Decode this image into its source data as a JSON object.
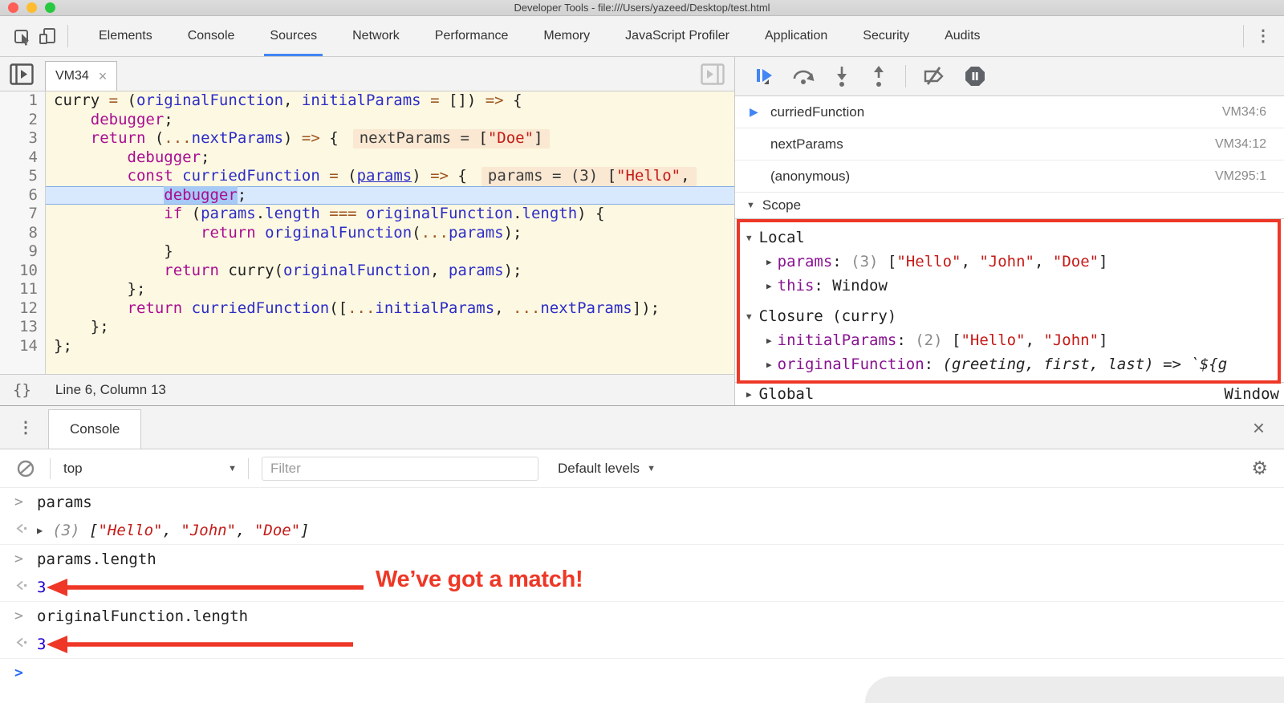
{
  "titlebar": {
    "title": "Developer Tools - file:///Users/yazeed/Desktop/test.html",
    "window_controls": [
      "close",
      "minimize",
      "zoom"
    ]
  },
  "main_toolbar": {
    "icons": [
      "inspect-icon",
      "device-toolbar-icon",
      "more-menu-icon"
    ],
    "tabs": [
      {
        "label": "Elements",
        "active": false
      },
      {
        "label": "Console",
        "active": false
      },
      {
        "label": "Sources",
        "active": true
      },
      {
        "label": "Network",
        "active": false
      },
      {
        "label": "Performance",
        "active": false
      },
      {
        "label": "Memory",
        "active": false
      },
      {
        "label": "JavaScript Profiler",
        "active": false
      },
      {
        "label": "Application",
        "active": false
      },
      {
        "label": "Security",
        "active": false
      },
      {
        "label": "Audits",
        "active": false
      }
    ]
  },
  "sources_panel": {
    "file_tab": {
      "label": "VM34",
      "close": "×"
    },
    "tabstrip_icons": [
      "navigator-toggle-icon",
      "debugger-pane-toggle-icon"
    ],
    "status_bar": {
      "pretty_print": "{}",
      "position": "Line 6, Column 13"
    },
    "code_lines": [
      {
        "num": 1,
        "tokens": [
          [
            "p",
            "curry "
          ],
          [
            "o",
            "="
          ],
          [
            "p",
            " ("
          ],
          [
            "v",
            "originalFunction"
          ],
          [
            "p",
            ", "
          ],
          [
            "v",
            "initialParams"
          ],
          [
            "p",
            " "
          ],
          [
            "o",
            "="
          ],
          [
            "p",
            " []) "
          ],
          [
            "o",
            "=>"
          ],
          [
            "p",
            " {"
          ]
        ]
      },
      {
        "num": 2,
        "tokens": [
          [
            "p",
            "    "
          ],
          [
            "k",
            "debugger"
          ],
          [
            "p",
            ";"
          ]
        ]
      },
      {
        "num": 3,
        "tokens": [
          [
            "p",
            "    "
          ],
          [
            "k",
            "return"
          ],
          [
            "p",
            " ("
          ],
          [
            "o",
            "..."
          ],
          [
            "v",
            "nextParams"
          ],
          [
            "p",
            ") "
          ],
          [
            "o",
            "=>"
          ],
          [
            "p",
            " {"
          ]
        ],
        "widget": [
          [
            "wp",
            "nextParams = "
          ],
          [
            "p",
            "["
          ],
          [
            "s",
            "\"Doe\""
          ],
          [
            "p",
            "]"
          ]
        ]
      },
      {
        "num": 4,
        "tokens": [
          [
            "p",
            "        "
          ],
          [
            "k",
            "debugger"
          ],
          [
            "p",
            ";"
          ]
        ]
      },
      {
        "num": 5,
        "tokens": [
          [
            "p",
            "        "
          ],
          [
            "k",
            "const"
          ],
          [
            "p",
            " "
          ],
          [
            "v",
            "curriedFunction"
          ],
          [
            "p",
            " "
          ],
          [
            "o",
            "="
          ],
          [
            "p",
            " ("
          ],
          [
            "vu",
            "params"
          ],
          [
            "p",
            ") "
          ],
          [
            "o",
            "=>"
          ],
          [
            "p",
            " {"
          ]
        ],
        "widget": [
          [
            "wp",
            "params = (3) "
          ],
          [
            "p",
            "["
          ],
          [
            "s",
            "\"Hello\""
          ],
          [
            "p",
            ","
          ]
        ]
      },
      {
        "num": 6,
        "highlight": true,
        "tokens": [
          [
            "p",
            "            "
          ],
          [
            "ksel",
            "debugger"
          ],
          [
            "p",
            ";"
          ]
        ]
      },
      {
        "num": 7,
        "tokens": [
          [
            "p",
            "            "
          ],
          [
            "k",
            "if"
          ],
          [
            "p",
            " ("
          ],
          [
            "v",
            "params"
          ],
          [
            "p",
            "."
          ],
          [
            "v",
            "length"
          ],
          [
            "p",
            " "
          ],
          [
            "o",
            "==="
          ],
          [
            "p",
            " "
          ],
          [
            "v",
            "originalFunction"
          ],
          [
            "p",
            "."
          ],
          [
            "v",
            "length"
          ],
          [
            "p",
            ") {"
          ]
        ]
      },
      {
        "num": 8,
        "tokens": [
          [
            "p",
            "                "
          ],
          [
            "k",
            "return"
          ],
          [
            "p",
            " "
          ],
          [
            "v",
            "originalFunction"
          ],
          [
            "p",
            "("
          ],
          [
            "o",
            "..."
          ],
          [
            "v",
            "params"
          ],
          [
            "p",
            ");"
          ]
        ]
      },
      {
        "num": 9,
        "tokens": [
          [
            "p",
            "            }"
          ]
        ]
      },
      {
        "num": 10,
        "tokens": [
          [
            "p",
            "            "
          ],
          [
            "k",
            "return"
          ],
          [
            "p",
            " curry("
          ],
          [
            "v",
            "originalFunction"
          ],
          [
            "p",
            ", "
          ],
          [
            "v",
            "params"
          ],
          [
            "p",
            ");"
          ]
        ]
      },
      {
        "num": 11,
        "tokens": [
          [
            "p",
            "        };"
          ]
        ]
      },
      {
        "num": 12,
        "tokens": [
          [
            "p",
            "        "
          ],
          [
            "k",
            "return"
          ],
          [
            "p",
            " "
          ],
          [
            "v",
            "curriedFunction"
          ],
          [
            "p",
            "(["
          ],
          [
            "o",
            "..."
          ],
          [
            "v",
            "initialParams"
          ],
          [
            "p",
            ", "
          ],
          [
            "o",
            "..."
          ],
          [
            "v",
            "nextParams"
          ],
          [
            "p",
            "]);"
          ]
        ]
      },
      {
        "num": 13,
        "tokens": [
          [
            "p",
            "    };"
          ]
        ]
      },
      {
        "num": 14,
        "tokens": [
          [
            "p",
            "};"
          ]
        ]
      }
    ]
  },
  "debugger_panel": {
    "controls": [
      "resume-button",
      "step-over-button",
      "step-into-button",
      "step-out-button",
      "deactivate-breakpoints-button",
      "pause-on-exceptions-button"
    ],
    "call_stack": [
      {
        "name": "curriedFunction",
        "location": "VM34:6",
        "current": true
      },
      {
        "name": "nextParams",
        "location": "VM34:12",
        "current": false
      },
      {
        "name": "(anonymous)",
        "location": "VM295:1",
        "current": false
      }
    ],
    "scope": {
      "header": "Scope",
      "sections": [
        {
          "title": "Local",
          "items": [
            {
              "tokens": [
                [
                  "prop",
                  "params"
                ],
                [
                  "p",
                  ": "
                ],
                [
                  "c",
                  "(3) "
                ],
                [
                  "p",
                  "["
                ],
                [
                  "s",
                  "\"Hello\""
                ],
                [
                  "p",
                  ", "
                ],
                [
                  "s",
                  "\"John\""
                ],
                [
                  "p",
                  ", "
                ],
                [
                  "s",
                  "\"Doe\""
                ],
                [
                  "p",
                  "]"
                ]
              ]
            },
            {
              "tokens": [
                [
                  "prop",
                  "this"
                ],
                [
                  "p",
                  ": Window"
                ]
              ]
            }
          ]
        },
        {
          "title": "Closure (curry)",
          "items": [
            {
              "tokens": [
                [
                  "prop",
                  "initialParams"
                ],
                [
                  "p",
                  ": "
                ],
                [
                  "c",
                  "(2) "
                ],
                [
                  "p",
                  "["
                ],
                [
                  "s",
                  "\"Hello\""
                ],
                [
                  "p",
                  ", "
                ],
                [
                  "s",
                  "\"John\""
                ],
                [
                  "p",
                  "]"
                ]
              ]
            },
            {
              "tokens": [
                [
                  "prop",
                  "originalFunction"
                ],
                [
                  "p",
                  ": "
                ],
                [
                  "i",
                  "(greeting, first, last) => `${g"
                ]
              ]
            }
          ]
        }
      ],
      "global_row": {
        "label": "Global",
        "value": "Window"
      }
    }
  },
  "console_drawer": {
    "tab": "Console",
    "close": "×",
    "toolbar": {
      "context": "top",
      "filter_placeholder": "Filter",
      "levels": "Default levels"
    },
    "messages": [
      {
        "type": "input",
        "tokens": [
          [
            "p",
            "params"
          ]
        ]
      },
      {
        "type": "result",
        "expand": true,
        "italic": true,
        "tokens": [
          [
            "c",
            "(3) "
          ],
          [
            "p",
            "["
          ],
          [
            "s",
            "\"Hello\""
          ],
          [
            "p",
            ", "
          ],
          [
            "s",
            "\"John\""
          ],
          [
            "p",
            ", "
          ],
          [
            "s",
            "\"Doe\""
          ],
          [
            "p",
            "]"
          ]
        ]
      },
      {
        "type": "input",
        "tokens": [
          [
            "p",
            "params.length"
          ]
        ]
      },
      {
        "type": "result",
        "tokens": [
          [
            "num",
            "3"
          ]
        ],
        "arrow": true
      },
      {
        "type": "input",
        "tokens": [
          [
            "p",
            "originalFunction.length"
          ]
        ]
      },
      {
        "type": "result",
        "tokens": [
          [
            "num",
            "3"
          ]
        ],
        "arrow": true
      },
      {
        "type": "prompt"
      }
    ]
  },
  "annotations": {
    "color": "#ee3726",
    "match_text": "We’ve got a match!",
    "scope_highlight_box": true
  }
}
